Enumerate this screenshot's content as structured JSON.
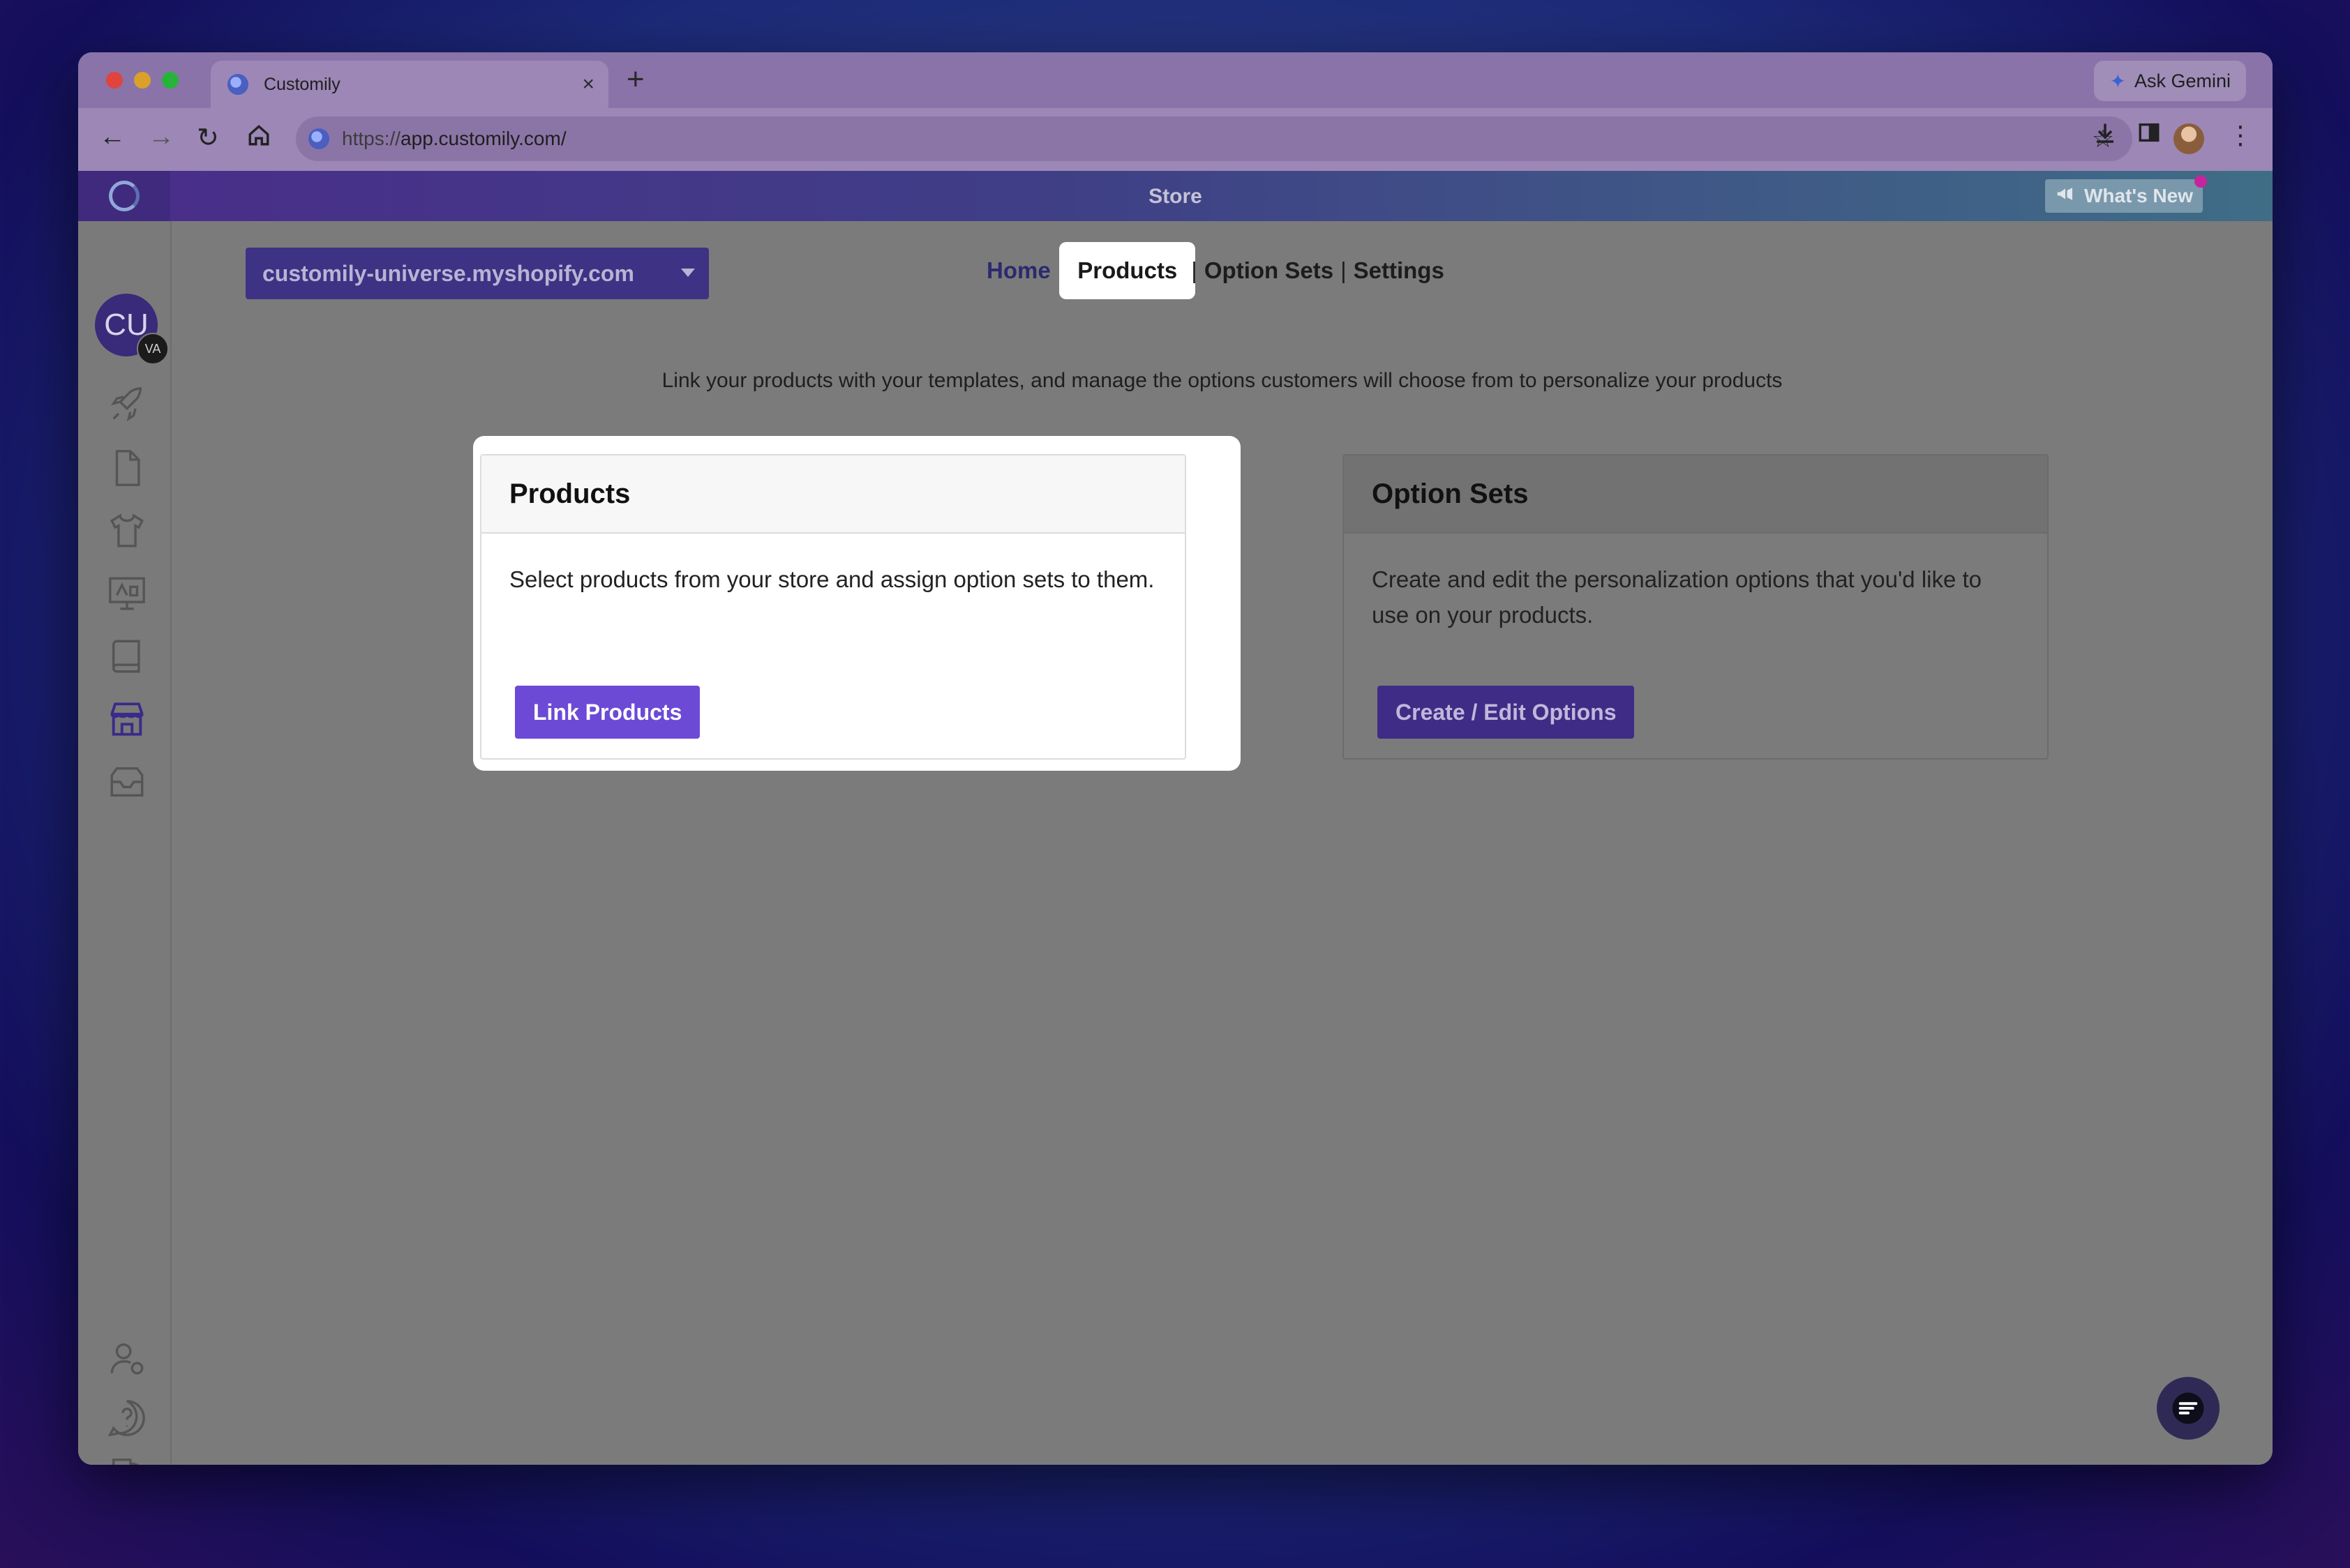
{
  "browser": {
    "tab_title": "Customily",
    "tab_close": "×",
    "new_tab": "+",
    "ask_gemini": "Ask Gemini",
    "url_scheme": "https://",
    "url_rest": "app.customily.com/"
  },
  "app": {
    "header_title": "Store",
    "whats_new": "What's New"
  },
  "sidebar": {
    "avatar_initials": "CU",
    "avatar_badge": "VA",
    "items": [
      {
        "icon": "rocket-icon"
      },
      {
        "icon": "document-icon"
      },
      {
        "icon": "tshirt-icon"
      },
      {
        "icon": "monitor-icon"
      },
      {
        "icon": "book-icon"
      },
      {
        "icon": "store-icon"
      },
      {
        "icon": "inbox-icon"
      }
    ],
    "bottom_items": [
      {
        "icon": "user-settings-icon"
      },
      {
        "icon": "help-icon"
      },
      {
        "icon": "logout-icon"
      }
    ]
  },
  "store_selector": {
    "value": "customily-universe.myshopify.com"
  },
  "topnav": {
    "home": "Home",
    "products": "Products",
    "option_sets": "Option Sets",
    "settings": "Settings",
    "separator": "|"
  },
  "subtitle": "Link your products with your templates, and manage the options customers will choose from to personalize your products",
  "cards": {
    "products": {
      "title": "Products",
      "description": "Select products from your store and assign option sets to them.",
      "button": "Link Products"
    },
    "option_sets": {
      "title": "Option Sets",
      "description": "Create and edit the personalization options that you'd like to use on your products.",
      "button": "Create / Edit Options"
    }
  },
  "colors": {
    "brand_purple": "#6c4ad6",
    "header_gradient_start": "#4a2d8a",
    "header_gradient_end": "#3f6d86"
  }
}
